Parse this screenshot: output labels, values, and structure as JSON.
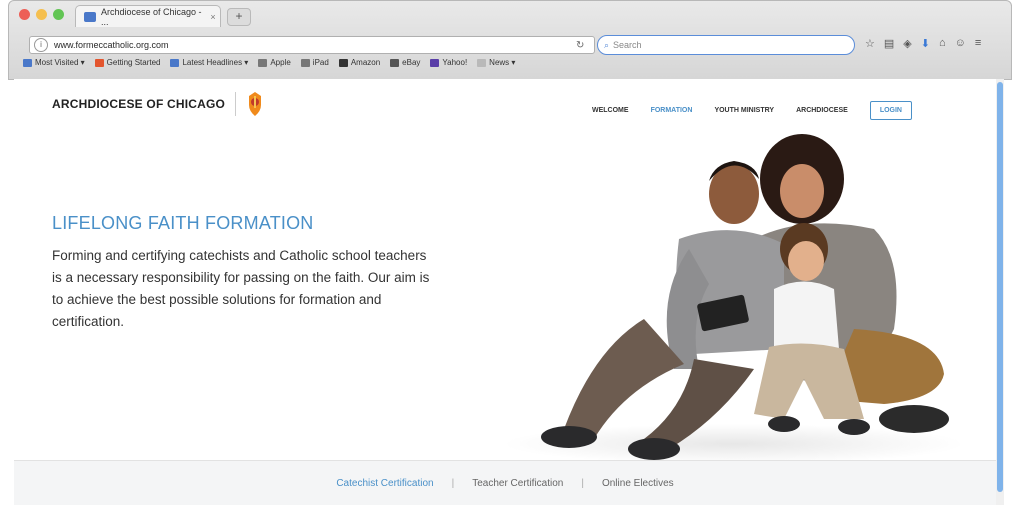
{
  "browser": {
    "tab_title": "Archdiocese of Chicago - ...",
    "new_tab": "+",
    "close_tab": "×",
    "url": "www.formeccatholic.org.com",
    "search_placeholder": "Search",
    "bookmarks": [
      {
        "label": "Most Visited ▾",
        "color": "#4a78c9"
      },
      {
        "label": "Getting Started",
        "color": "#e3552e"
      },
      {
        "label": "Latest Headlines ▾",
        "color": "#4a78c9"
      },
      {
        "label": "Apple",
        "color": "#777777"
      },
      {
        "label": "iPad",
        "color": "#777777"
      },
      {
        "label": "Amazon",
        "color": "#333333"
      },
      {
        "label": "eBay",
        "color": "#555555"
      },
      {
        "label": "Yahoo!",
        "color": "#5a3ea8"
      },
      {
        "label": "News ▾",
        "color": "#b9b9b9"
      }
    ]
  },
  "site": {
    "logo_text": "ARCHDIOCESE OF CHICAGO",
    "nav": [
      {
        "label": "WELCOME",
        "active": false
      },
      {
        "label": "FORMATION",
        "active": true
      },
      {
        "label": "YOUTH MINISTRY",
        "active": false
      },
      {
        "label": "ARCHDIOCESE",
        "active": false
      }
    ],
    "login": "LOGIN",
    "hero_title": "LIFELONG FAITH FORMATION",
    "hero_body": "Forming and certifying catechists and Catholic school teachers is a necessary responsibility for passing on the faith. Our aim is to achieve the best possible solutions for formation and certification.",
    "footer_links": [
      "Catechist Certification",
      "Teacher Certification",
      "Online Electives"
    ],
    "footer_separator": "|",
    "accent_color": "#4a90c8"
  }
}
